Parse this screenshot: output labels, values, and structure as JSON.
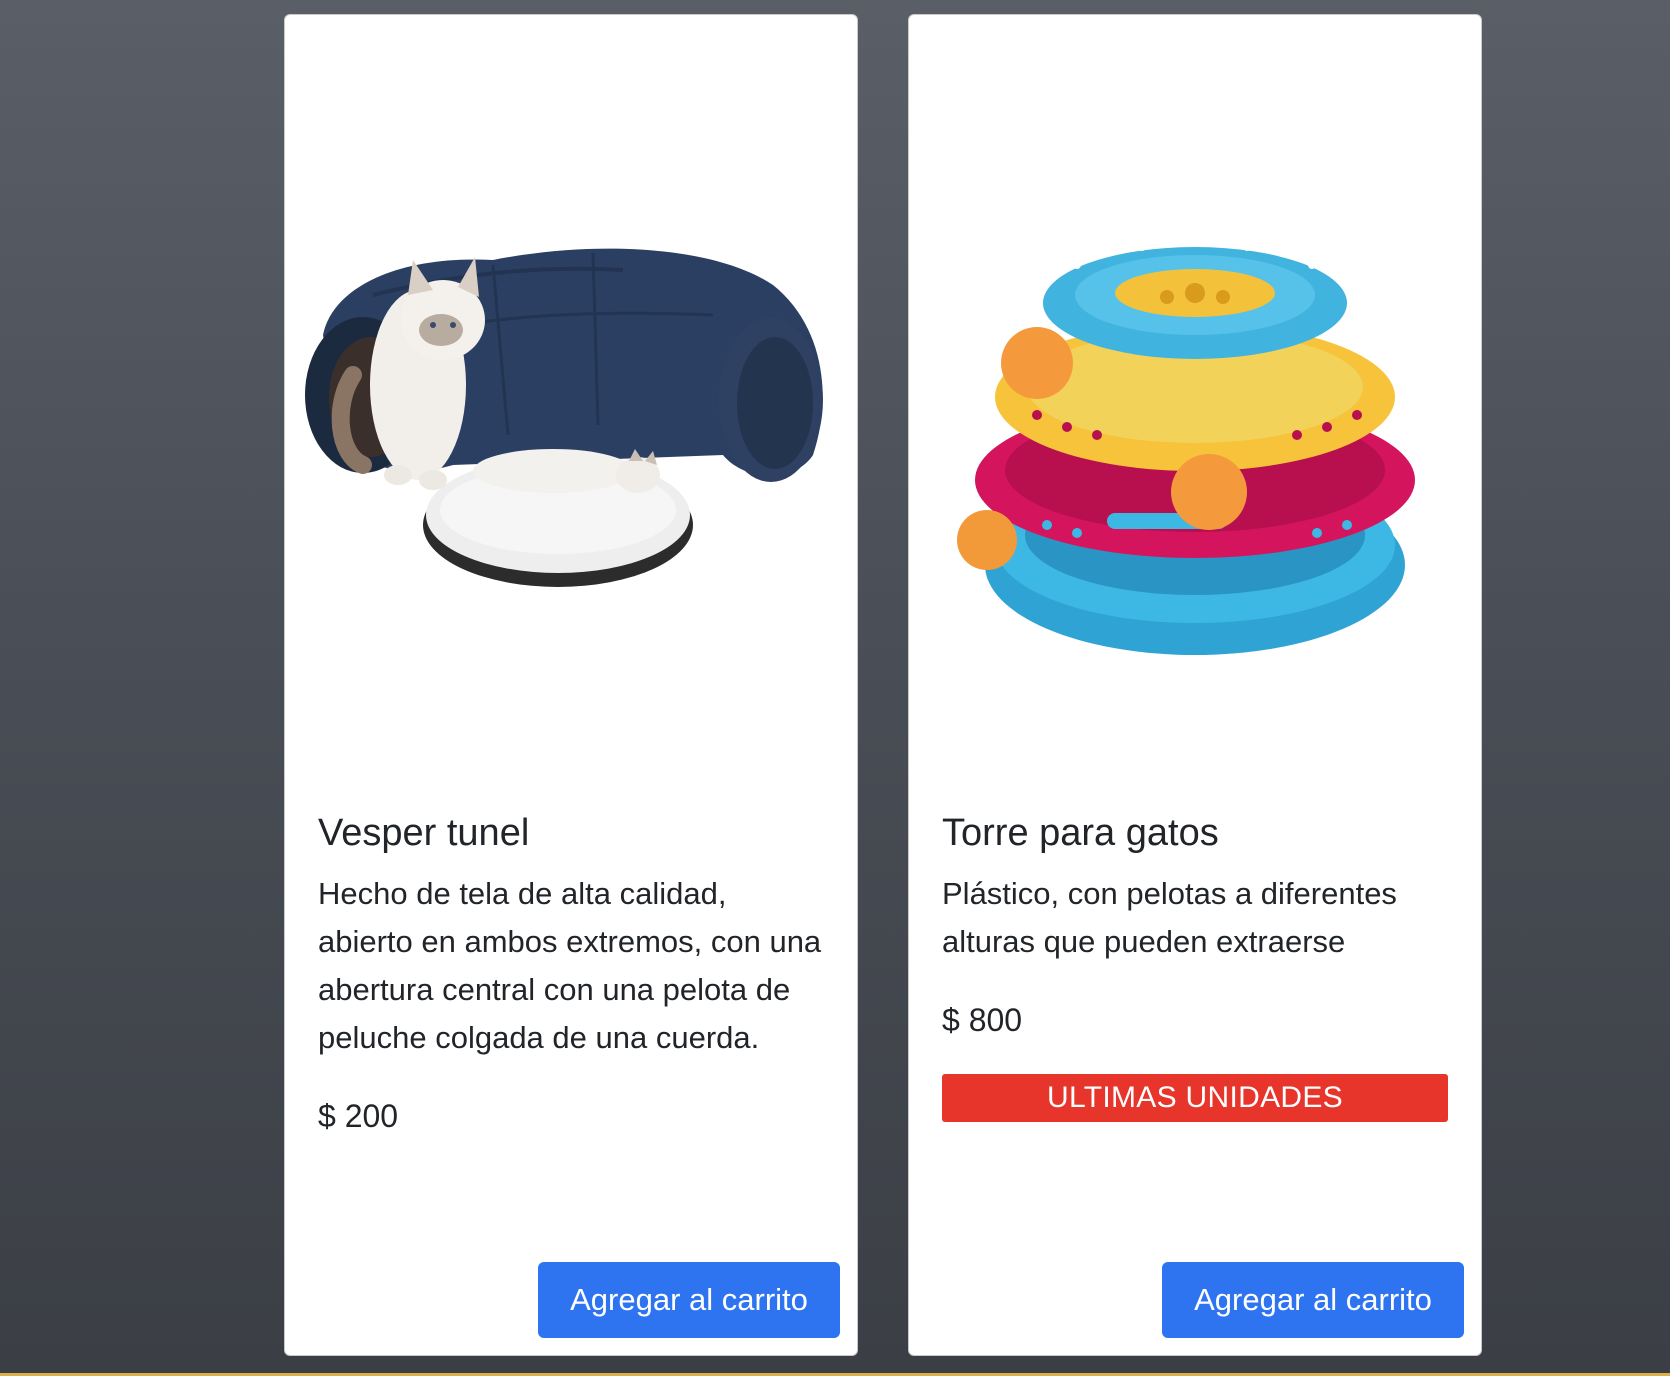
{
  "products": [
    {
      "title": "Vesper tunel",
      "description": "Hecho de tela de alta calidad, abierto en ambos extremos, con una abertura central con una pelota de peluche colgada de una cuerda.",
      "price": "$ 200",
      "button_label": "Agregar al carrito",
      "image_icon": "cat-tunnel-image"
    },
    {
      "title": "Torre para gatos",
      "description": "Plástico, con pelotas a diferentes alturas que pueden extraerse",
      "price": "$ 800",
      "badge": "ULTIMAS UNIDADES",
      "button_label": "Agregar al carrito",
      "image_icon": "cat-tower-toy-image"
    }
  ],
  "colors": {
    "button": "#2e74f1",
    "badge": "#e8352b",
    "card": "#ffffff"
  }
}
